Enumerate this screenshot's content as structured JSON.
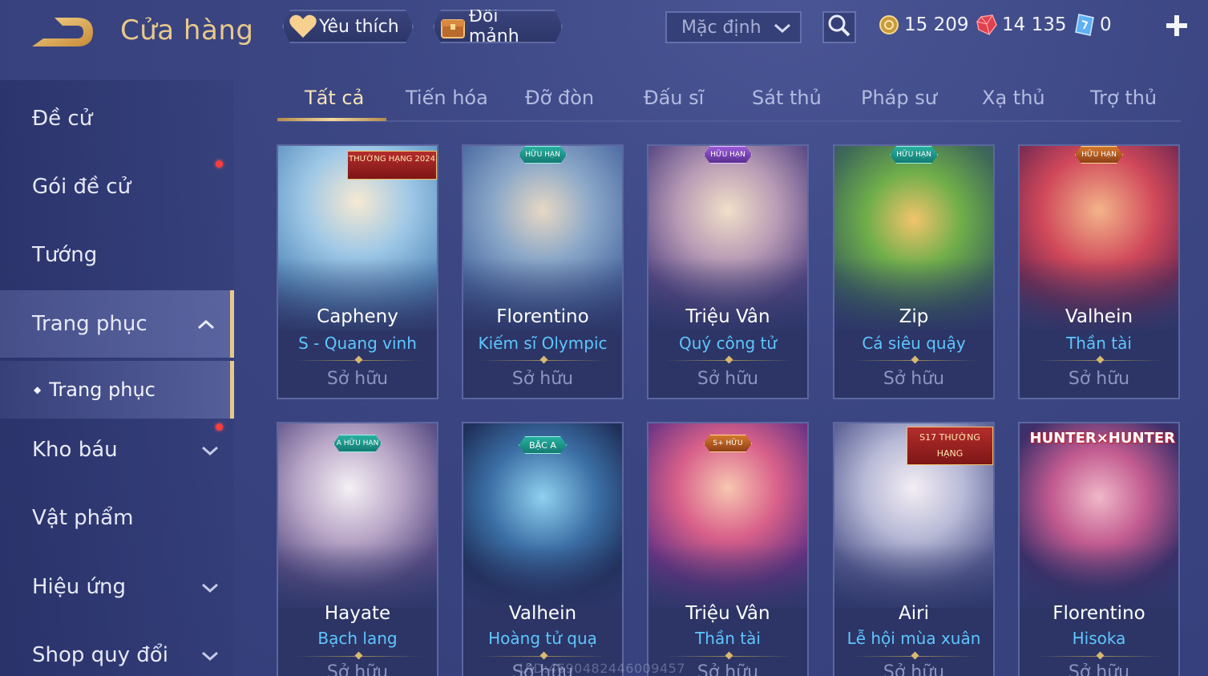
{
  "header": {
    "title": "Cửa hàng",
    "favorite_label": "Yêu thích",
    "exchange_label": "Đổi mảnh",
    "sort_value": "Mặc định",
    "gold": "15 209",
    "gems": "14 135",
    "vouchers": "0"
  },
  "sidebar": {
    "items": [
      {
        "label": "Đề cử"
      },
      {
        "label": "Gói đề cử"
      },
      {
        "label": "Tướng"
      },
      {
        "label": "Trang phục"
      },
      {
        "label": "Trang phục"
      },
      {
        "label": "Kho báu"
      },
      {
        "label": "Vật phẩm"
      },
      {
        "label": "Hiệu ứng"
      },
      {
        "label": "Shop quy đổi"
      }
    ]
  },
  "tabs": [
    {
      "label": "Tất cả"
    },
    {
      "label": "Tiến hóa"
    },
    {
      "label": "Đỡ đòn"
    },
    {
      "label": "Đấu sĩ"
    },
    {
      "label": "Sát thủ"
    },
    {
      "label": "Pháp sư"
    },
    {
      "label": "Xạ thủ"
    },
    {
      "label": "Trợ thủ"
    }
  ],
  "cards": [
    {
      "hero": "Capheny",
      "skin": "S - Quang vinh",
      "status": "Sở hữu",
      "badge": "THƯỜNG HẠNG 2024"
    },
    {
      "hero": "Florentino",
      "skin": "Kiếm sĩ Olympic",
      "status": "Sở hữu",
      "badge": "HỮU HẠN"
    },
    {
      "hero": "Triệu Vân",
      "skin": "Quý công tử",
      "status": "Sở hữu",
      "badge": "HỮU HẠN"
    },
    {
      "hero": "Zip",
      "skin": "Cá siêu quậy",
      "status": "Sở hữu",
      "badge": "HỮU HẠN"
    },
    {
      "hero": "Valhein",
      "skin": "Thần tài",
      "status": "Sở hữu",
      "badge": "HỮU HẠN"
    },
    {
      "hero": "Hayate",
      "skin": "Bạch lang",
      "status": "Sở hữu",
      "badge": "A HỮU HẠN"
    },
    {
      "hero": "Valhein",
      "skin": "Hoàng tử quạ",
      "status": "Sở hữu",
      "badge": "BẬC A"
    },
    {
      "hero": "Triệu Vân",
      "skin": "Thần tài",
      "status": "Sở hữu",
      "badge": "S+ HỮU HẠN"
    },
    {
      "hero": "Airi",
      "skin": "Lễ hội mùa xuân",
      "status": "Sở hữu",
      "badge": "S17 THƯỜNG HẠNG"
    },
    {
      "hero": "Florentino",
      "skin": "Hisoka",
      "status": "Sở hữu",
      "badge": "HUNTER×HUNTER"
    }
  ],
  "uid": "UID:4690482446009457",
  "colors": {
    "accent_gold": "#e9c98a",
    "skin_blue": "#5fc6ff",
    "bg": "#3b4683"
  }
}
